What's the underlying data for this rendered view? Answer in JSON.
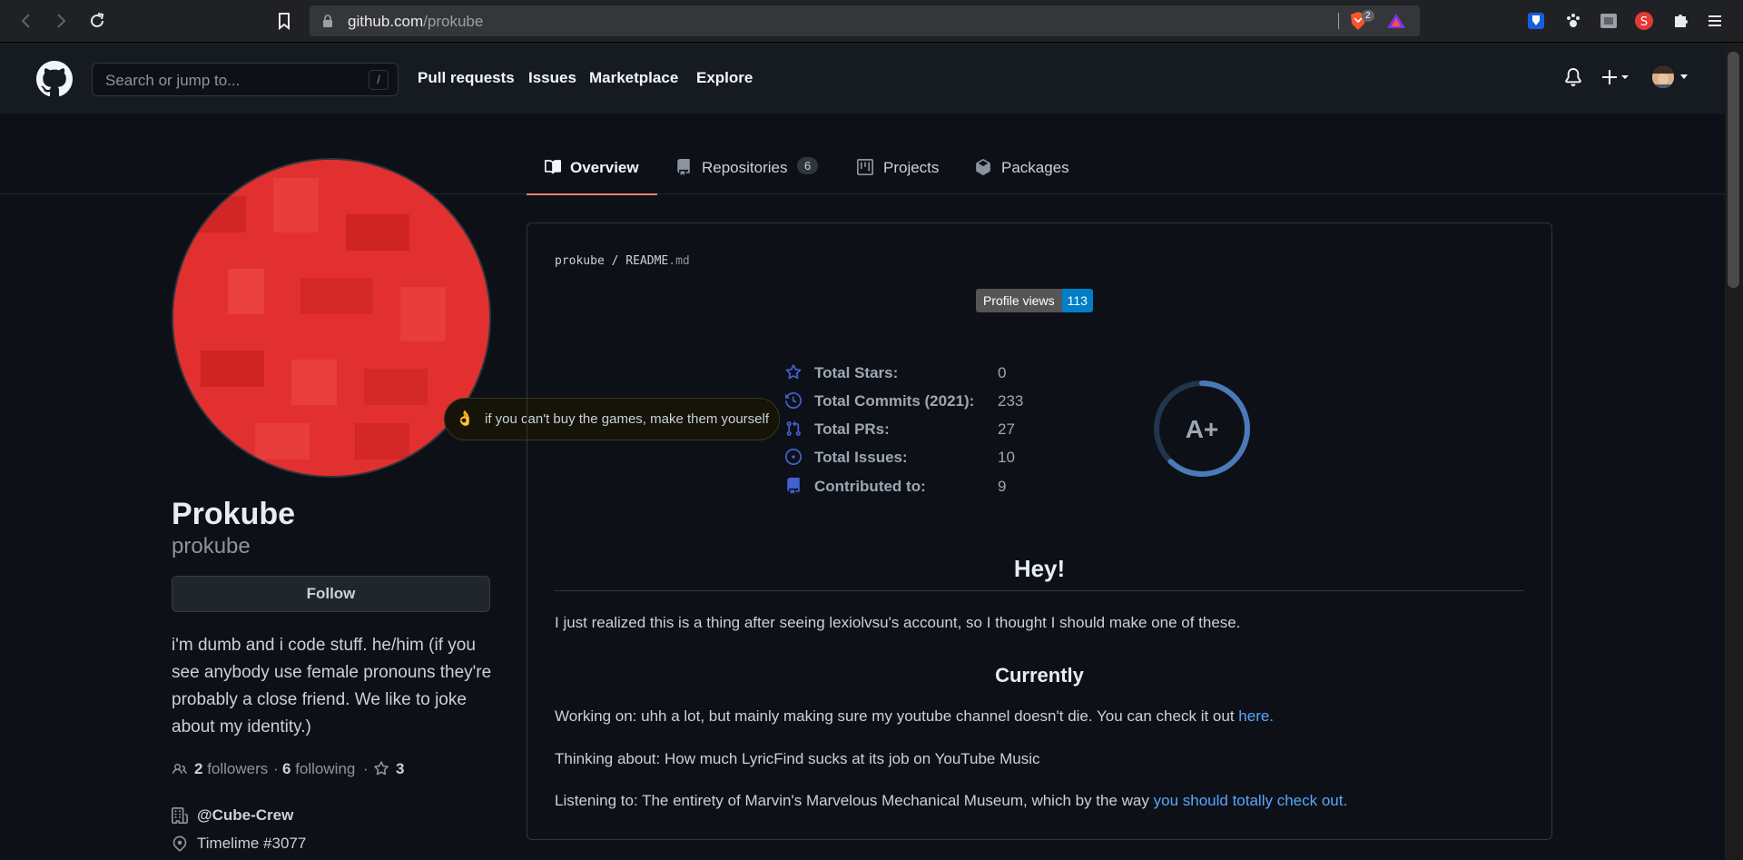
{
  "browser": {
    "url_host": "github.com",
    "url_path": "/prokube",
    "brave_badge": "2"
  },
  "header": {
    "search_placeholder": "Search or jump to...",
    "search_shortcut": "/",
    "nav": [
      "Pull requests",
      "Issues",
      "Marketplace",
      "Explore"
    ]
  },
  "tabs": {
    "overview": "Overview",
    "repositories": "Repositories",
    "repositories_count": "6",
    "projects": "Projects",
    "packages": "Packages"
  },
  "profile": {
    "status_emoji": "👌",
    "status_text": "if you can't buy the games, make them yourself",
    "name": "Prokube",
    "login": "prokube",
    "follow_label": "Follow",
    "bio": "i'm dumb and i code stuff. he/him (if you see anybody use female pronouns they're probably a close friend. We like to joke about my identity.)",
    "followers_count": "2",
    "followers_label": "followers",
    "following_count": "6",
    "following_label": "following",
    "stars_count": "3",
    "organization": "@Cube-Crew",
    "location": "Timelime #3077"
  },
  "readme": {
    "path_user": "prokube",
    "path_sep": "/",
    "path_file": "README",
    "path_ext": ".md",
    "views_label": "Profile views",
    "views_count": "113",
    "stats": [
      {
        "label": "Total Stars:",
        "value": "0",
        "icon": "star-icon"
      },
      {
        "label": "Total Commits (2021):",
        "value": "233",
        "icon": "history-icon"
      },
      {
        "label": "Total PRs:",
        "value": "27",
        "icon": "pull-request-icon"
      },
      {
        "label": "Total Issues:",
        "value": "10",
        "icon": "issue-icon"
      },
      {
        "label": "Contributed to:",
        "value": "9",
        "icon": "repo-icon"
      }
    ],
    "grade": "A+",
    "grade_progress": 0.62,
    "heading_hey": "Hey!",
    "intro": "I just realized this is a thing after seeing lexiolvsu's account, so I thought I should make one of these.",
    "heading_currently": "Currently",
    "working_on": "Working on: uhh a lot, but mainly making sure my youtube channel doesn't die. You can check it out ",
    "working_link": "here.",
    "thinking_about": "Thinking about: How much LyricFind sucks at its job on YouTube Music",
    "listening_to": "Listening to: The entirety of Marvin's Marvelous Mechanical Museum, which by the way ",
    "listening_link": "you should totally check out."
  },
  "colors": {
    "accent": "#f78166",
    "link": "#58a6ff",
    "views_badge": "#007ec6",
    "avatar": "#e02b2b"
  }
}
